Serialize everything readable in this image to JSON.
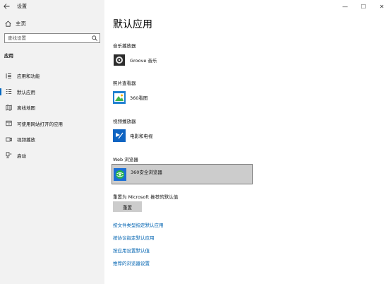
{
  "window": {
    "title": "设置",
    "controls": [
      "—",
      "☐",
      "✕"
    ]
  },
  "sidebar": {
    "home_label": "主页",
    "search_placeholder": "查找设置",
    "section": "应用",
    "items": [
      {
        "label": "应用和功能",
        "icon": "apps-features-icon"
      },
      {
        "label": "默认应用",
        "icon": "default-apps-icon",
        "active": true
      },
      {
        "label": "离线地图",
        "icon": "offline-maps-icon"
      },
      {
        "label": "可使用网站打开的应用",
        "icon": "apps-for-websites-icon"
      },
      {
        "label": "视频播放",
        "icon": "video-playback-icon"
      },
      {
        "label": "启动",
        "icon": "startup-icon"
      }
    ]
  },
  "main": {
    "title": "默认应用",
    "categories": [
      {
        "label": "音乐播放器",
        "app": "Groove 音乐",
        "icon": "groove-music-icon"
      },
      {
        "label": "照片查看器",
        "app": "360看图",
        "icon": "photo-viewer-icon"
      },
      {
        "label": "视频播放器",
        "app": "电影和电视",
        "icon": "movies-tv-icon"
      },
      {
        "label": "Web 浏览器",
        "app": "360安全浏览器",
        "icon": "browser-360-icon"
      }
    ],
    "reset_label": "重置为 Microsoft 推荐的默认值",
    "reset_button": "重置",
    "links": [
      "按文件类型指定默认应用",
      "按协议指定默认应用",
      "按应用设置默认值",
      "推荐的浏览器设置"
    ]
  },
  "colors": {
    "accent": "#0067c0",
    "link": "#0063b1",
    "sidebar_bg": "#f2f2f2",
    "selected_bg": "#cccccc"
  }
}
